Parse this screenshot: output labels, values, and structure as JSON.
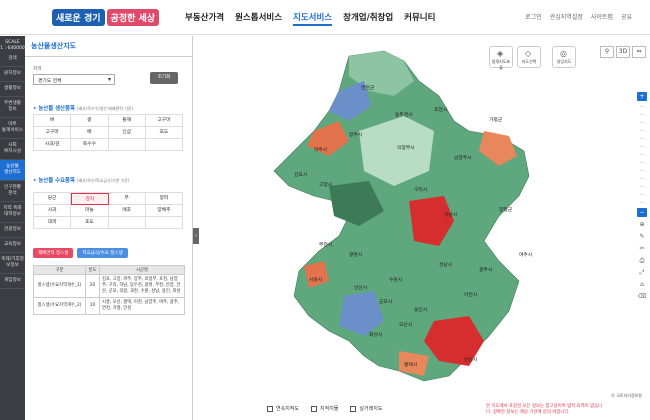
{
  "header": {
    "logo": [
      "새로운 경기",
      "공정한 세상"
    ],
    "nav": [
      "부동산가격",
      "원스톱서비스",
      "지도서비스",
      "창개업/취창업",
      "커뮤니티"
    ],
    "active_nav_index": 2,
    "utils": [
      "로그인",
      "관심지역설정",
      "사이트맵",
      "공유"
    ]
  },
  "rail": {
    "scale": "SCALE\n1 : 640000",
    "items": [
      "검색",
      "원지정보",
      "생활정보",
      "주변생활\n정보",
      "마트\n통계서비스",
      "사회\n복지시설",
      "농산물\n생산지도",
      "인구현황\n분석",
      "지역 특화\n대학정보",
      "관광정보",
      "교육정보",
      "축제/기후정\n보정보",
      "게임정보"
    ],
    "active_index": 6
  },
  "panel": {
    "title": "농산물생산지도",
    "region_label": "지역",
    "region_value": "경기도 전체",
    "query_button": "조기화",
    "production_title": "• 농산물 생산품목",
    "production_note": "(배추/옥수수/생산 배배면적 기준)",
    "production_items": [
      "벼",
      "콩",
      "들깨",
      "고구마",
      "고구마",
      "배",
      "인삼",
      "포도",
      "사과/감",
      "옥수수",
      "",
      ""
    ],
    "demand_title": "• 농산물 수요품목",
    "demand_note": "(배추/옥수/학교급식/기관 기준)",
    "demand_items": [
      "당근",
      "감자",
      "무",
      "양파",
      "사과",
      "마늘",
      "애호",
      "양배추",
      "대파",
      "포도",
      "",
      ""
    ],
    "selected_demand_index": 1,
    "btn_red": "재배면적 정스생",
    "btn_blue": "학교급식/수요 정스생",
    "table": {
      "headers": [
        "구분",
        "빈도",
        "시군명"
      ],
      "rows": [
        {
          "label": "항스생(수요지역개수_1)",
          "count": "20",
          "cities": "김포, 고양, 파주, 양주, 의정부, 포천, 남양주, 구리, 하남, 동두천, 광명, 부천, 안양, 안산, 군포, 의왕, 과천, 수원, 성남, 용인, 화성"
        },
        {
          "label": "항스생(수요지역개수_2)",
          "count": "10",
          "cities": "시흥, 오산, 평택, 이천, 남양주, 여주, 광주, 연천, 가평, 안성"
        }
      ]
    }
  },
  "map": {
    "tools": [
      "범례지도표출",
      "지도선택",
      "영업지도"
    ],
    "topright": [
      "⚲",
      "3D",
      "⇔"
    ],
    "vtools": [
      "+",
      "—",
      "—",
      "—",
      "—",
      "—",
      "—",
      "—",
      "—",
      "—",
      "—",
      "—",
      "—",
      "—",
      "−"
    ],
    "vtools2": [
      "⊕",
      "✎",
      "✂",
      "⎙",
      "⤢",
      "⌂",
      "⌫"
    ],
    "legend": [
      "연속지적도",
      "지적지물",
      "실거래지도"
    ],
    "disclaimer": "본 지도에서 포함된 모든 정보는 참고용이며 법적 효력이 없습니다. 정확한 정보는 해당 기관에 문의 바랍니다.",
    "copyright": "© 국토지리정보원",
    "places": [
      "연천군",
      "동두천시",
      "포천시",
      "가평군",
      "양주시",
      "의정부시",
      "남양주시",
      "파주시",
      "고양시",
      "구리시",
      "하남시",
      "양평군",
      "김포시",
      "부천시",
      "광명시",
      "시흥시",
      "안산시",
      "수원시",
      "성남시",
      "광주시",
      "여주시",
      "용인시",
      "이천시",
      "화성시",
      "오산시",
      "평택시",
      "안성시",
      "군포시"
    ]
  }
}
